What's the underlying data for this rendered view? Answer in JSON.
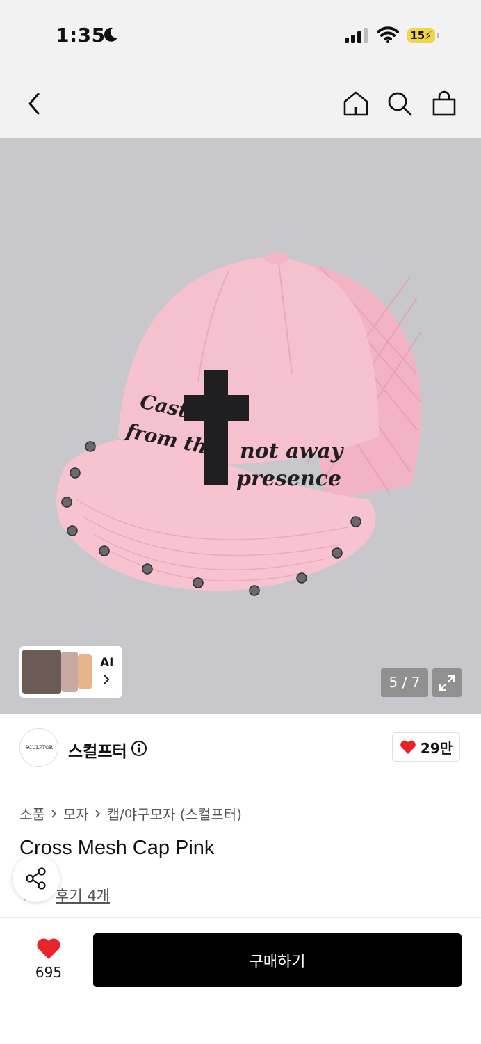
{
  "status": {
    "time": "1:35",
    "battery": "15"
  },
  "nav": {
    "back_icon": "chevron-left-icon",
    "home_icon": "home-icon",
    "search_icon": "search-icon",
    "cart_icon": "shopping-bag-icon"
  },
  "hero": {
    "counter": "5 / 7",
    "embroidery": {
      "left": [
        "Cast me",
        "from thy"
      ],
      "right": [
        "not away",
        "presence"
      ]
    },
    "ai_label": "AI"
  },
  "brand": {
    "logo_text": "SCULPTOR",
    "name": "스컬프터",
    "likes": "29만"
  },
  "breadcrumb": [
    "소품",
    "모자",
    "캡/야구모자 (스컬프터)"
  ],
  "product": {
    "title": "Cross Mesh Cap Pink",
    "reviews": "후기 4개"
  },
  "bottom": {
    "wish_count": "695",
    "buy_label": "구매하기"
  },
  "colors": {
    "accent": "#e8242b",
    "buy_bg": "#000000",
    "hat_pink": "#f5bfce"
  }
}
